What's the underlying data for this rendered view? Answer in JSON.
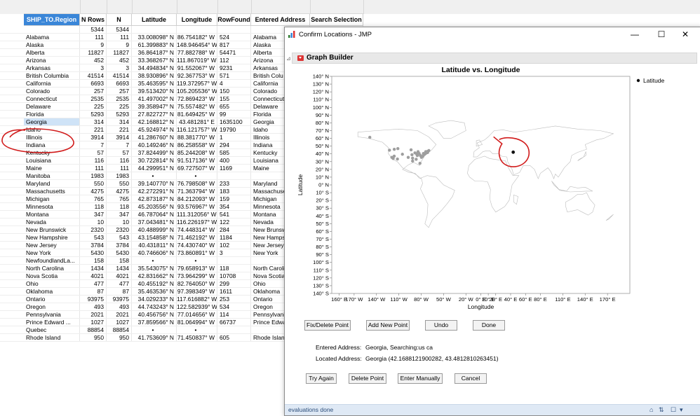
{
  "table": {
    "columns": [
      "SHIP_TO.Region",
      "N Rows",
      "N",
      "Latitude",
      "Longitude",
      "RowFound",
      "Entered Address",
      "Search Selection"
    ],
    "selected_column": 0,
    "totals": [
      "",
      "5344",
      "5344",
      "",
      "",
      "",
      "",
      ""
    ],
    "rows": [
      [
        "Alabama",
        "111",
        "111",
        "33.008098° N",
        "86.754182° W",
        "524",
        "Alabama",
        ""
      ],
      [
        "Alaska",
        "9",
        "9",
        "61.399883° N",
        "148.946454° W",
        "817",
        "Alaska",
        ""
      ],
      [
        "Alberta",
        "11827",
        "11827",
        "36.864187° N",
        "77.882788° W",
        "54471",
        "Alberta",
        ""
      ],
      [
        "Arizona",
        "452",
        "452",
        "33.368267° N",
        "111.867019° W",
        "112",
        "Arizona",
        ""
      ],
      [
        "Arkansas",
        "3",
        "3",
        "34.494834° N",
        "91.552067° W",
        "9231",
        "Arkansas",
        ""
      ],
      [
        "British Columbia",
        "41514",
        "41514",
        "38.930896° N",
        "92.367753° W",
        "571",
        "British Colu",
        ""
      ],
      [
        "California",
        "6693",
        "6693",
        "35.463595° N",
        "119.372957° W",
        "4",
        "California",
        ""
      ],
      [
        "Colorado",
        "257",
        "257",
        "39.513420° N",
        "105.205536° W",
        "150",
        "Colorado",
        ""
      ],
      [
        "Connecticut",
        "2535",
        "2535",
        "41.497002° N",
        "72.869423° W",
        "155",
        "Connecticut",
        ""
      ],
      [
        "Delaware",
        "225",
        "225",
        "39.358947° N",
        "75.557482° W",
        "655",
        "Delaware",
        ""
      ],
      [
        "Florida",
        "5293",
        "5293",
        "27.822727° N",
        "81.649425° W",
        "99",
        "Florida",
        ""
      ],
      [
        "Georgia",
        "314",
        "314",
        "42.168812° N",
        "43.481281° E",
        "1635100",
        "Georgia",
        ""
      ],
      [
        "Idaho",
        "221",
        "221",
        "45.924974° N",
        "116.121757° W",
        "19790",
        "Idaho",
        ""
      ],
      [
        "Illinois",
        "3914",
        "3914",
        "41.286760° N",
        "88.381770° W",
        "1",
        "Illinois",
        ""
      ],
      [
        "Indiana",
        "7",
        "7",
        "40.149246° N",
        "86.258558° W",
        "294",
        "Indiana",
        ""
      ],
      [
        "Kentucky",
        "57",
        "57",
        "37.824499° N",
        "85.244208° W",
        "585",
        "Kentucky",
        ""
      ],
      [
        "Louisiana",
        "116",
        "116",
        "30.722814° N",
        "91.517136° W",
        "400",
        "Louisiana",
        ""
      ],
      [
        "Maine",
        "111",
        "111",
        "44.299951° N",
        "69.727507° W",
        "1169",
        "Maine",
        ""
      ],
      [
        "Manitoba",
        "1983",
        "1983",
        "•",
        "•",
        "",
        "",
        ""
      ],
      [
        "Maryland",
        "550",
        "550",
        "39.140770° N",
        "76.798508° W",
        "233",
        "Maryland",
        ""
      ],
      [
        "Massachusetts",
        "4275",
        "4275",
        "42.272291° N",
        "71.363794° W",
        "183",
        "Massachuse",
        ""
      ],
      [
        "Michigan",
        "765",
        "765",
        "42.873187° N",
        "84.212093° W",
        "159",
        "Michigan",
        ""
      ],
      [
        "Minnesota",
        "118",
        "118",
        "45.203556° N",
        "93.576967° W",
        "354",
        "Minnesota",
        ""
      ],
      [
        "Montana",
        "347",
        "347",
        "46.787064° N",
        "111.312056° W",
        "541",
        "Montana",
        ""
      ],
      [
        "Nevada",
        "10",
        "10",
        "37.043481° N",
        "116.226197° W",
        "122",
        "Nevada",
        ""
      ],
      [
        "New Brunswick",
        "2320",
        "2320",
        "40.488999° N",
        "74.448314° W",
        "284",
        "New Brunsw",
        ""
      ],
      [
        "New Hampshire",
        "543",
        "543",
        "43.154858° N",
        "71.462192° W",
        "1184",
        "New Hamps",
        ""
      ],
      [
        "New Jersey",
        "3784",
        "3784",
        "40.431811° N",
        "74.430740° W",
        "102",
        "New Jersey",
        ""
      ],
      [
        "New York",
        "5430",
        "5430",
        "40.746606° N",
        "73.860891° W",
        "3",
        "New York",
        ""
      ],
      [
        "NewfoundlandLa...",
        "158",
        "158",
        "•",
        "•",
        "",
        "",
        ""
      ],
      [
        "North Carolina",
        "1434",
        "1434",
        "35.543075° N",
        "79.658913° W",
        "118",
        "North Caroli",
        ""
      ],
      [
        "Nova Scotia",
        "4021",
        "4021",
        "42.831662° N",
        "73.964299° W",
        "10708",
        "Nova Scotia",
        ""
      ],
      [
        "Ohio",
        "477",
        "477",
        "40.455192° N",
        "82.764050° W",
        "299",
        "Ohio",
        ""
      ],
      [
        "Oklahoma",
        "87",
        "87",
        "35.463536° N",
        "97.398349° W",
        "1611",
        "Oklahoma",
        ""
      ],
      [
        "Ontario",
        "93975",
        "93975",
        "34.029233° N",
        "117.616882° W",
        "253",
        "Ontario",
        ""
      ],
      [
        "Oregon",
        "493",
        "493",
        "44.743243° N",
        "122.582939° W",
        "534",
        "Oregon",
        ""
      ],
      [
        "Pennsylvania",
        "2021",
        "2021",
        "40.456756° N",
        "77.014656° W",
        "114",
        "Pennsylvani",
        ""
      ],
      [
        "Prince Edward ...",
        "1027",
        "1027",
        "37.859566° N",
        "81.064994° W",
        "66737",
        "Prince Edwa",
        ""
      ],
      [
        "Quebec",
        "88854",
        "88854",
        "•",
        "•",
        "",
        "",
        ""
      ],
      [
        "Rhode Island",
        "950",
        "950",
        "41.753609° N",
        "71.450837° W",
        "605",
        "Rhode Island",
        "us ca"
      ]
    ],
    "highlighted_row": 11
  },
  "dialog": {
    "title": "Confirm Locations - JMP",
    "app_icon": "jmp-icon",
    "window_buttons": {
      "minimize": "—",
      "maximize": "☐",
      "close": "✕"
    },
    "panel_title": "Graph Builder",
    "entered_address_label": "Entered Address:",
    "entered_address_value": "Georgia,   Searching:us ca",
    "located_address_label": "Located Address:",
    "located_address_value": "Georgia  (42.1688121900282, 43.4812810263451)",
    "buttons_row1": [
      "Fix/Delete Point",
      "Add New Point",
      "Undo",
      "Done"
    ],
    "buttons_row2": [
      "Try Again",
      "Delete Point",
      "Enter Manually",
      "Cancel"
    ],
    "status_text": "evaluations done"
  },
  "chart_data": {
    "type": "scatter",
    "title": "Latitude vs. Longitude",
    "xlabel": "Longitude",
    "ylabel": "Latitude",
    "legend": [
      "Latitude"
    ],
    "legend_position": "right",
    "xlim": [
      -200,
      200
    ],
    "ylim": [
      -140,
      140
    ],
    "x_ticks": [
      "160° E",
      "170° W",
      "140° W",
      "110° W",
      "80° W",
      "50° W",
      "20° W",
      "0° E",
      "10° E",
      "20° E",
      "40° E",
      "60° E",
      "80° E",
      "110° E",
      "140° E",
      "170° E"
    ],
    "y_ticks": [
      "140° N",
      "130° N",
      "120° N",
      "110° N",
      "100° N",
      "90° N",
      "80° N",
      "70° N",
      "60° N",
      "50° N",
      "40° N",
      "30° N",
      "20° N",
      "10° N",
      "0° N",
      "10° S",
      "20° S",
      "30° S",
      "40° S",
      "50° S",
      "60° S",
      "70° S",
      "80° S",
      "90° S",
      "100° S",
      "110° S",
      "120° S",
      "130° S",
      "140° S"
    ],
    "highlight_point": {
      "x": 43.48,
      "y": 42.17
    },
    "points_x": [
      -86.75,
      -148.95,
      -77.88,
      -111.87,
      -91.55,
      -92.37,
      -119.37,
      -105.21,
      -72.87,
      -75.56,
      -81.65,
      -116.12,
      -88.38,
      -86.26,
      -85.24,
      -91.52,
      -69.73,
      -76.8,
      -71.36,
      -84.21,
      -93.58,
      -111.31,
      -116.23,
      -74.45,
      -71.46,
      -74.43,
      -73.86,
      -79.66,
      -73.96,
      -82.76,
      -97.4,
      -117.62,
      -122.58,
      -77.01,
      -81.06,
      -71.45
    ],
    "points_y": [
      33.01,
      61.4,
      36.86,
      33.37,
      34.49,
      38.93,
      35.46,
      39.51,
      41.5,
      39.36,
      27.82,
      45.92,
      41.29,
      40.15,
      37.82,
      30.72,
      44.3,
      39.14,
      42.27,
      42.87,
      45.2,
      46.79,
      37.04,
      40.49,
      43.15,
      40.43,
      40.75,
      35.54,
      42.83,
      40.46,
      35.46,
      34.03,
      44.74,
      40.46,
      37.86,
      41.75
    ],
    "grid": false
  },
  "colors": {
    "accent": "#3a86d8",
    "annotation": "#d11a1a",
    "status_bar": "#dfe9f5"
  }
}
